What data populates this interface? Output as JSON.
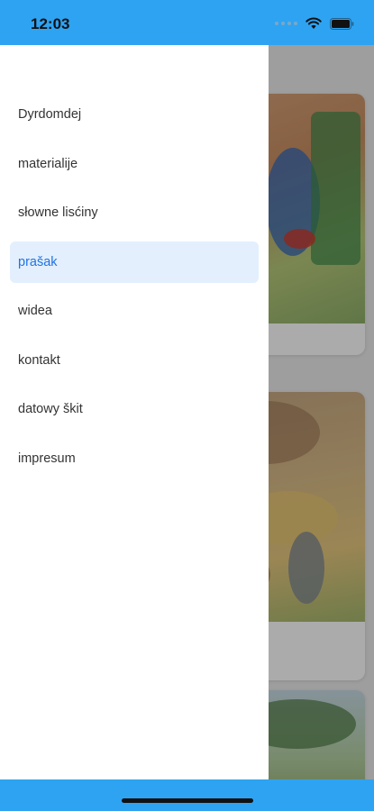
{
  "status_bar": {
    "time": "12:03",
    "background_color": "#2ea3f2",
    "icons": [
      "signal-dots-icon",
      "wifi-icon",
      "battery-icon"
    ]
  },
  "drawer": {
    "items": [
      {
        "label": "Dyrdomdej",
        "active": false
      },
      {
        "label": "materialije",
        "active": false
      },
      {
        "label": "słowne lisćiny",
        "active": false
      },
      {
        "label": "prašak",
        "active": true
      },
      {
        "label": "widea",
        "active": false
      },
      {
        "label": "kontakt",
        "active": false
      },
      {
        "label": "datowy škit",
        "active": false
      },
      {
        "label": "impresum",
        "active": false
      }
    ],
    "active_color": "#1f73e3",
    "active_background": "#e3effd"
  },
  "colors": {
    "accent": "#2ea3f2",
    "text": "#333333"
  }
}
